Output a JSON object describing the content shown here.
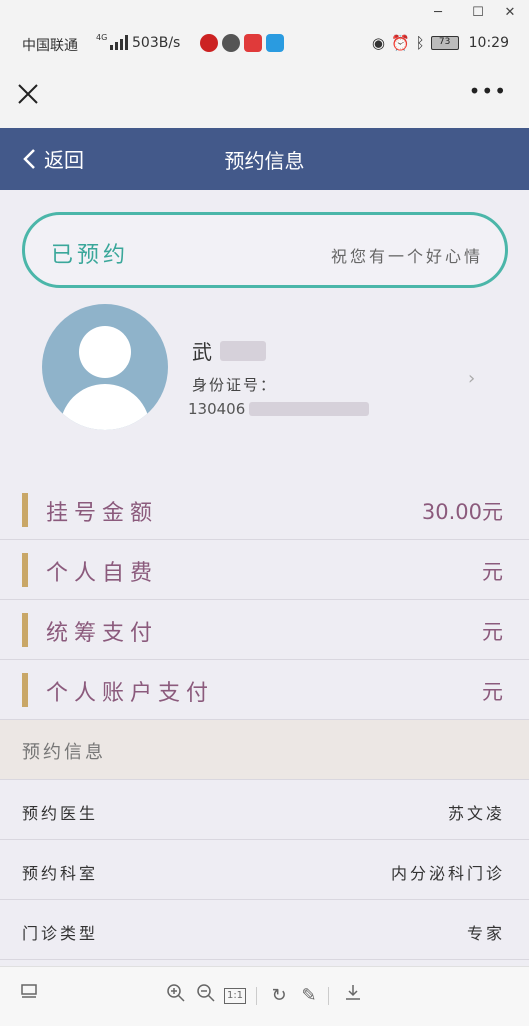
{
  "status_bar": {
    "carrier": "中国联通",
    "network": "4G",
    "speed": "503B/s",
    "battery": "73",
    "time": "10:29"
  },
  "page": {
    "back_label": "返回",
    "title": "预约信息"
  },
  "status_card": {
    "status": "已预约",
    "wish": "祝您有一个好心情"
  },
  "profile": {
    "name_visible": "武",
    "id_label": "身份证号：",
    "id_prefix": "130406"
  },
  "fees": [
    {
      "label": "挂号金额",
      "value": "30.00元"
    },
    {
      "label": "个人自费",
      "value": "元"
    },
    {
      "label": "统筹支付",
      "value": "元"
    },
    {
      "label": "个人账户支付",
      "value": "元"
    }
  ],
  "section": {
    "title": "预约信息"
  },
  "info": [
    {
      "label": "预约医生",
      "value": "苏文凌"
    },
    {
      "label": "预约科室",
      "value": "内分泌科门诊"
    },
    {
      "label": "门诊类型",
      "value": "专家"
    }
  ],
  "toolbar": {
    "zoom_ratio": "1:1"
  },
  "colors": {
    "header_bg": "#43598a",
    "accent_teal": "#4bb6a9",
    "fee_text": "#8b5a7c",
    "fee_bar": "#c9a767"
  }
}
